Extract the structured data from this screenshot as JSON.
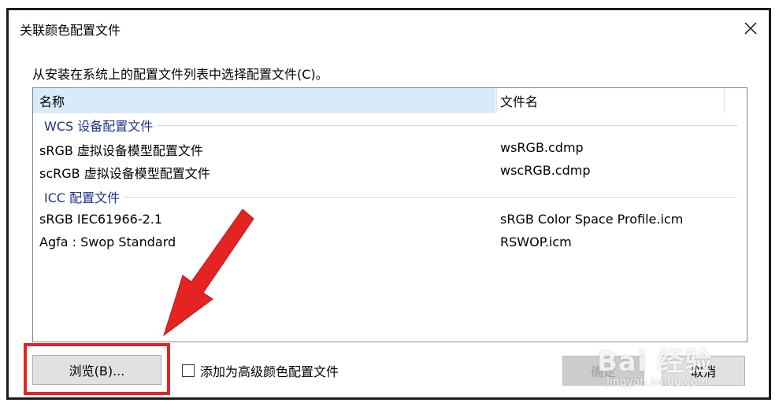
{
  "dialog": {
    "title": "关联颜色配置文件",
    "instruction": "从安装在系统上的配置文件列表中选择配置文件(C)。"
  },
  "list": {
    "columns": {
      "name": "名称",
      "file": "文件名"
    },
    "groups": [
      {
        "label": "WCS 设备配置文件",
        "rows": [
          {
            "name": "sRGB 虚拟设备模型配置文件",
            "file": "wsRGB.cdmp"
          },
          {
            "name": "scRGB 虚拟设备模型配置文件",
            "file": "wscRGB.cdmp"
          }
        ]
      },
      {
        "label": "ICC 配置文件",
        "rows": [
          {
            "name": "sRGB IEC61966-2.1",
            "file": "sRGB Color Space Profile.icm"
          },
          {
            "name": "Agfa : Swop Standard",
            "file": "RSWOP.icm"
          }
        ]
      }
    ]
  },
  "footer": {
    "browse_label": "浏览(B)...",
    "checkbox_label": "添加为高级颜色配置文件",
    "checkbox_checked": false,
    "ok_label": "确定",
    "cancel_label": "取消"
  },
  "annotation": {
    "highlight_color": "#e62323"
  },
  "watermark": {
    "brand": "Bai 经验",
    "url": "jingyan.baidu.com"
  },
  "icons": {
    "close": "close-icon",
    "arrow": "red-arrow-annotation",
    "paw": "baidu-paw-icon"
  },
  "colors": {
    "header_selected": "#d9ebf9",
    "group_text": "#1e3287",
    "accent_red": "#e62323"
  }
}
